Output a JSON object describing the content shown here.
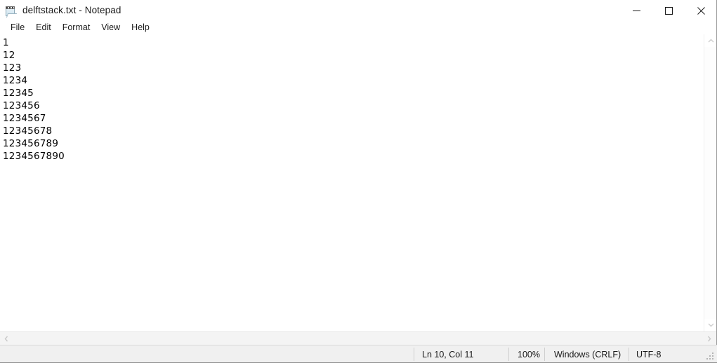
{
  "window": {
    "title": "delftstack.txt - Notepad",
    "icon": "notepad-icon",
    "controls": {
      "minimize": "minimize-icon",
      "maximize": "maximize-icon",
      "close": "close-icon"
    }
  },
  "menu": {
    "items": [
      {
        "label": "File"
      },
      {
        "label": "Edit"
      },
      {
        "label": "Format"
      },
      {
        "label": "View"
      },
      {
        "label": "Help"
      }
    ]
  },
  "editor": {
    "lines": [
      "1",
      "12",
      "123",
      "1234",
      "12345",
      "123456",
      "1234567",
      "12345678",
      "123456789",
      "1234567890"
    ]
  },
  "scrollbars": {
    "vertical": {
      "up": "chevron-up-icon",
      "down": "chevron-down-icon"
    },
    "horizontal": {
      "left": "chevron-left-icon",
      "right": "chevron-right-icon"
    }
  },
  "statusbar": {
    "cursor_position": "Ln 10, Col 11",
    "zoom": "100%",
    "line_endings": "Windows (CRLF)",
    "encoding": "UTF-8"
  },
  "colors": {
    "window_bg": "#ffffff",
    "statusbar_bg": "#f0f0f0",
    "text": "#1a1a1a",
    "separator": "#d0d0d0"
  }
}
